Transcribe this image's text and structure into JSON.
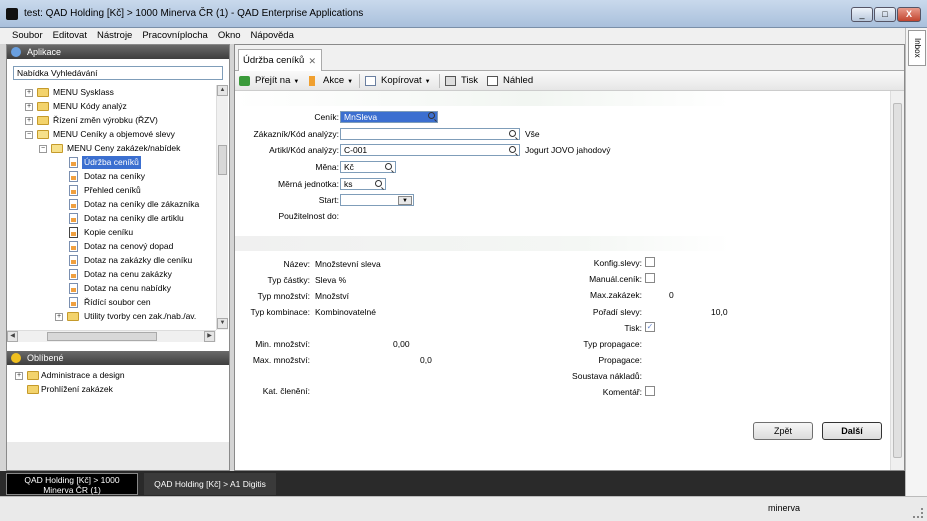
{
  "window": {
    "title": "test: QAD Holding [Kč] > 1000 Minerva ČR (1) - QAD Enterprise Applications",
    "min": "_",
    "max": "□",
    "close": "X"
  },
  "menu": [
    "Soubor",
    "Editovat",
    "Nástroje",
    "Pracovníplocha",
    "Okno",
    "Nápověda"
  ],
  "inbox_label": "Inbox",
  "left": {
    "apps_title": "Aplikace",
    "search_placeholder": "Nabídka Vyhledávání",
    "tree": [
      {
        "label": "MENU Sysklass"
      },
      {
        "label": "MENU Kódy analýz"
      },
      {
        "label": "Řízení změn výrobku (ŘZV)"
      },
      {
        "label": "MENU Ceníky a objemové slevy"
      },
      {
        "label": "MENU Ceny zakázek/nabídek"
      },
      {
        "label": "Údržba ceníků"
      },
      {
        "label": "Dotaz na ceníky"
      },
      {
        "label": "Přehled ceníků"
      },
      {
        "label": "Dotaz na ceníky dle zákazníka"
      },
      {
        "label": "Dotaz na ceníky dle artiklu"
      },
      {
        "label": "Kopie ceníku"
      },
      {
        "label": "Dotaz na cenový dopad"
      },
      {
        "label": "Dotaz na zakázky dle ceníku"
      },
      {
        "label": "Dotaz na cenu zakázky"
      },
      {
        "label": "Dotaz na cenu nabídky"
      },
      {
        "label": "Řídící soubor cen"
      },
      {
        "label": "Utility tvorby cen zak./nab./av."
      }
    ],
    "fav_title": "Oblíbené",
    "favorites": [
      {
        "label": "Administrace a design"
      },
      {
        "label": "Prohlížení zakázek"
      }
    ]
  },
  "main": {
    "tab_label": "Údržba ceníků",
    "tab_close": "✕",
    "toolbar": {
      "goto": "Přejít na",
      "actions": "Akce",
      "copy": "Kopírovat",
      "print": "Tisk",
      "preview": "Náhled"
    },
    "form": {
      "cenik_label": "Ceník:",
      "cenik_value": "MnSleva",
      "zakaznik_label": "Zákazník/Kód analýzy:",
      "zakaznik_desc": "Vše",
      "artikl_label": "Artikl/Kód analýzy:",
      "artikl_value": "C-001",
      "artikl_desc": "Jogurt JOVO jahodový",
      "mena_label": "Měna:",
      "mena_value": "Kč",
      "mj_label": "Měrná jednotka:",
      "mj_value": "ks",
      "start_label": "Start:",
      "pouzitelnost_label": "Použitelnost do:"
    },
    "details": {
      "nazev_label": "Název:",
      "nazev_value": "Množstevní sleva",
      "typ_castky_label": "Typ částky:",
      "typ_castky_value": "Sleva %",
      "typ_mnozstvi_label": "Typ množství:",
      "typ_mnozstvi_value": "Množství",
      "typ_kombinace_label": "Typ kombinace:",
      "typ_kombinace_value": "Kombinovatelné",
      "min_label": "Min. množství:",
      "min_value": "0,00",
      "max_label": "Max. množství:",
      "max_value": "0,0",
      "kat_label": "Kat. členění:",
      "konfig_label": "Konfig.slevy:",
      "manual_label": "Manuál.ceník:",
      "maxzak_label": "Max.zakázek:",
      "maxzak_value": "0",
      "poradi_label": "Pořadí slevy:",
      "poradi_value": "10,0",
      "tisk_label": "Tisk:",
      "tisk_checked": "✓",
      "typprop_label": "Typ propagace:",
      "prop_label": "Propagace:",
      "soustava_label": "Soustava nákladů:",
      "komentar_label": "Komentář:"
    },
    "buttons": {
      "back": "Zpět",
      "next": "Další"
    }
  },
  "bottom_tabs": [
    {
      "line1": "QAD Holding [Kč] > 1000",
      "line2": "Minerva ČR (1)"
    },
    {
      "line1": "QAD Holding [Kč] > A1 Digitis",
      "line2": ""
    }
  ],
  "status": {
    "user": "minerva"
  }
}
